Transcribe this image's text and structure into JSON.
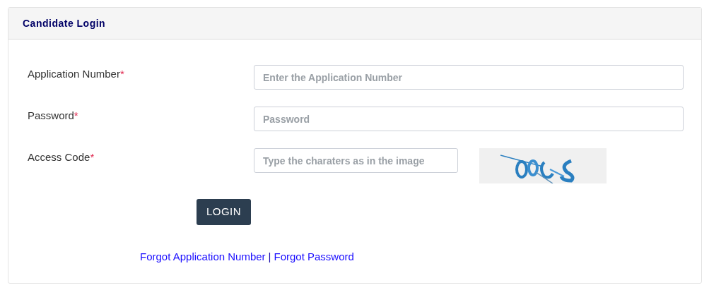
{
  "panel": {
    "title": "Candidate Login"
  },
  "fields": [
    {
      "kind": "text",
      "label": "Application Number",
      "required_mark": "*",
      "placeholder": "Enter the Application Number"
    },
    {
      "kind": "password",
      "label": "Password",
      "required_mark": "*",
      "placeholder": "Password"
    },
    {
      "kind": "captcha",
      "label": "Access Code",
      "required_mark": "*",
      "placeholder": "Type the charaters as in the image"
    }
  ],
  "login_button": "LOGIN",
  "links": [
    {
      "label": "Forgot Application Number"
    },
    {
      "label": "Forgot Password"
    }
  ],
  "link_separator": "|"
}
